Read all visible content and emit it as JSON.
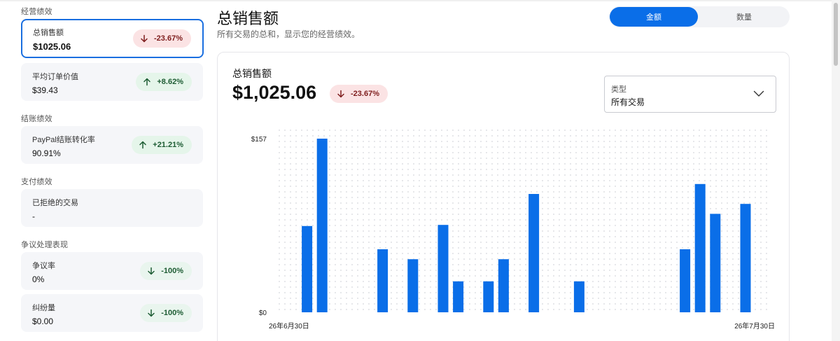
{
  "sidebar": {
    "sections": [
      {
        "title": "经营绩效",
        "cards": [
          {
            "label": "总销售额",
            "value": "$1025.06",
            "delta": "-23.67%",
            "direction": "down",
            "tone": "negative",
            "selected": true
          },
          {
            "label": "平均订单价值",
            "value": "$39.43",
            "delta": "+8.62%",
            "direction": "up",
            "tone": "positive",
            "selected": false
          }
        ]
      },
      {
        "title": "结账绩效",
        "cards": [
          {
            "label": "PayPal结账转化率",
            "value": "90.91%",
            "delta": "+21.21%",
            "direction": "up",
            "tone": "positive",
            "selected": false
          }
        ]
      },
      {
        "title": "支付绩效",
        "cards": [
          {
            "label": "已拒绝的交易",
            "value": "-",
            "delta": "",
            "direction": "",
            "tone": "",
            "selected": false
          }
        ]
      },
      {
        "title": "争议处理表现",
        "cards": [
          {
            "label": "争议率",
            "value": "0%",
            "delta": "-100%",
            "direction": "down",
            "tone": "positive",
            "selected": false
          },
          {
            "label": "纠纷量",
            "value": "$0.00",
            "delta": "-100%",
            "direction": "down",
            "tone": "positive",
            "selected": false
          }
        ]
      }
    ]
  },
  "header": {
    "title": "总销售额",
    "subtitle": "所有交易的总和，显示您的经营绩效。",
    "toggle": {
      "options": [
        "金额",
        "数量"
      ],
      "selected": "金额"
    }
  },
  "card": {
    "title": "总销售额",
    "value": "$1,025.06",
    "delta": "-23.67%",
    "type_select": {
      "label": "类型",
      "value": "所有交易"
    }
  },
  "colors": {
    "accent": "#0a6ee8",
    "bar": "#0a6ee8",
    "negative_badge_bg": "#fbe3e4",
    "positive_badge_bg": "#e5f5ea"
  },
  "chart_data": {
    "type": "bar",
    "x_start_label": "26年6月30日",
    "x_end_label": "26年7月30日",
    "y_tick_labels": [
      "$157",
      "$0"
    ],
    "ylim": [
      0,
      157
    ],
    "grid": "dotted",
    "values": [
      0,
      78,
      157,
      0,
      0,
      0,
      57,
      0,
      48,
      0,
      79,
      28,
      0,
      28,
      48,
      0,
      107,
      0,
      0,
      28,
      0,
      0,
      0,
      0,
      0,
      0,
      57,
      116,
      89,
      0,
      98,
      0
    ]
  }
}
